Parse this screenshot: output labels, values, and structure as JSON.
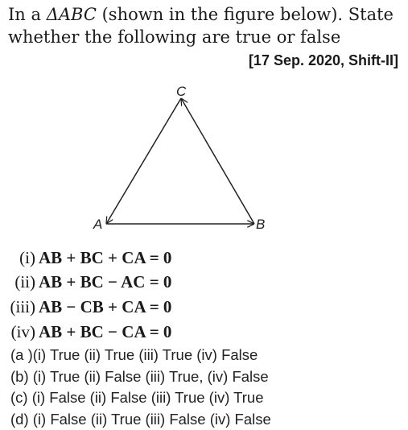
{
  "question": {
    "prefix": "In a ",
    "triangle": "ΔABC",
    "suffix": " (shown in the figure below). State whether the following are true or false"
  },
  "source": "[17 Sep. 2020, Shift-II]",
  "figure": {
    "labels": {
      "a": "A",
      "b": "B",
      "c": "C"
    }
  },
  "statements": [
    {
      "num": "(i)",
      "expr": "AB + BC + CA = 0"
    },
    {
      "num": "(ii)",
      "expr": "AB + BC − AC = 0"
    },
    {
      "num": "(iii)",
      "expr": "AB − CB + CA = 0"
    },
    {
      "num": "(iv)",
      "expr": "AB + BC − CA = 0"
    }
  ],
  "options": [
    {
      "text": "(a )(i) True (ii) True (iii) True (iv) False"
    },
    {
      "text": "(b) (i) True (ii) False (iii) True, (iv) False"
    },
    {
      "text": "(c) (i) False (ii) False (iii) True (iv) True"
    },
    {
      "text": "(d) (i) False (ii) True (iii) False (iv) False"
    }
  ]
}
